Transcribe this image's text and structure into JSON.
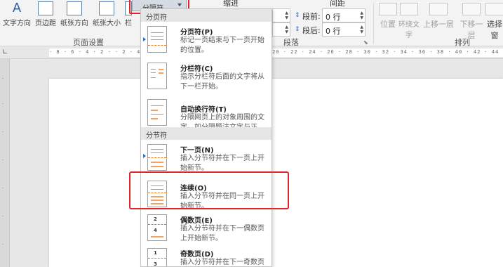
{
  "ribbon": {
    "page_setup": {
      "group_label": "页面设置",
      "buttons": [
        "文字方向",
        "页边距",
        "纸张方向",
        "纸张大小",
        "栏"
      ]
    },
    "breaks_button": {
      "label": "分隔符"
    },
    "indent_label": "缩进",
    "spacing_label": "间距",
    "paragraph": {
      "group_label": "段落",
      "before_label": "段前:",
      "before_value": "0 行",
      "after_label": "段后:",
      "after_value": "0 行"
    },
    "arrange": {
      "group_label": "排列",
      "buttons": [
        "位置",
        "环绕文字",
        "上移一层",
        "下移一层",
        "选择窗"
      ]
    }
  },
  "dropdown": {
    "page_breaks_header": "分页符",
    "section_breaks_header": "分节符",
    "items": [
      {
        "title": "分页符(P)",
        "desc": "标记一页结束与下一页开始的位置。"
      },
      {
        "title": "分栏符(C)",
        "desc": "指示分栏符后面的文字将从下一栏开始。"
      },
      {
        "title": "自动换行符(T)",
        "desc": "分隔网页上的对象周围的文字，如分隔题注文字与正文。"
      },
      {
        "title": "下一页(N)",
        "desc": "插入分节符并在下一页上开始新节。"
      },
      {
        "title": "连续(O)",
        "desc": "插入分节符并在同一页上开始新节。"
      },
      {
        "title": "偶数页(E)",
        "desc": "插入分节符并在下一偶数页上开始新节。"
      },
      {
        "title": "奇数页(D)",
        "desc": "插入分节符并在下一奇数页上开始新节。"
      }
    ]
  },
  "icons": {
    "even_page_numbers": [
      "2",
      "4"
    ],
    "odd_page_numbers": [
      "1",
      "3"
    ]
  },
  "colors": {
    "highlight_red": "#e0262a",
    "accent_orange": "#f3a261",
    "page_bg": "#ffffff"
  }
}
